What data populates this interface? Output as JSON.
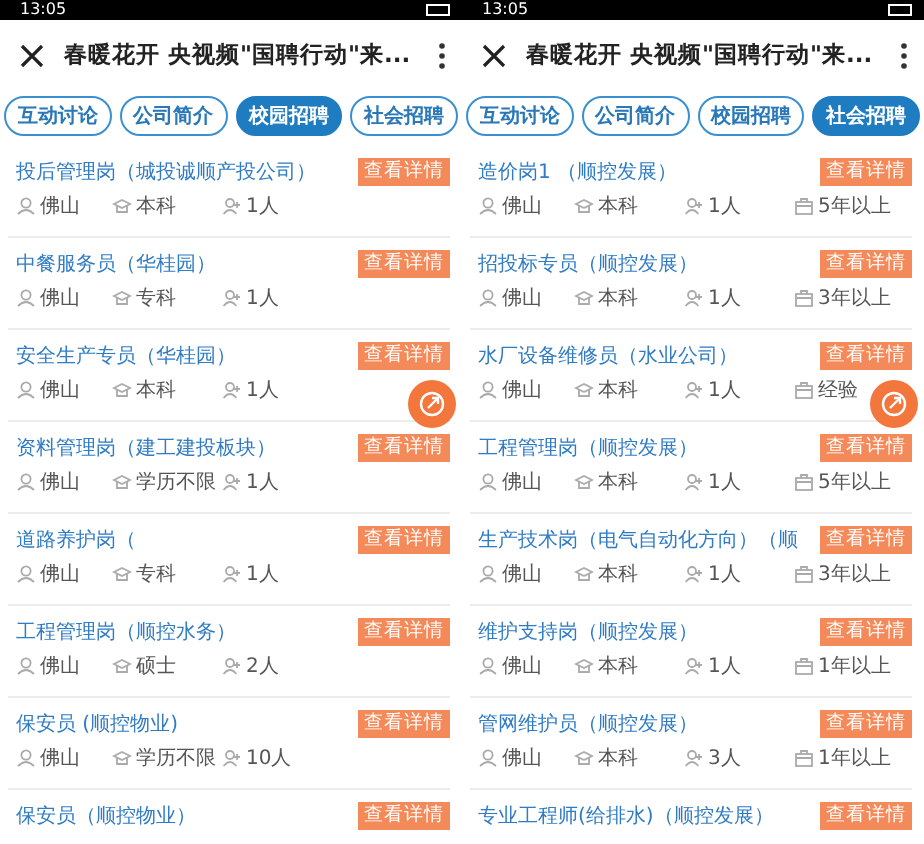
{
  "panels": [
    {
      "status_bar": {
        "time": "13:05"
      },
      "header": {
        "title": "春暖花开 央视频\"国聘行动\"来..."
      },
      "tabs": [
        {
          "label": "互动讨论",
          "selected": false
        },
        {
          "label": "公司简介",
          "selected": false
        },
        {
          "label": "校园招聘",
          "selected": true
        },
        {
          "label": "社会招聘",
          "selected": false
        }
      ],
      "jobs": [
        {
          "title": "投后管理岗（城投诚顺产投公司）",
          "button": "查看详情",
          "meta": [
            {
              "kind": "location",
              "text": "佛山"
            },
            {
              "kind": "education",
              "text": "本科"
            },
            {
              "kind": "headcount",
              "text": "1人"
            }
          ]
        },
        {
          "title": "中餐服务员（华桂园）",
          "button": "查看详情",
          "meta": [
            {
              "kind": "location",
              "text": "佛山"
            },
            {
              "kind": "education",
              "text": "专科"
            },
            {
              "kind": "headcount",
              "text": "1人"
            }
          ]
        },
        {
          "title": "安全生产专员（华桂园）",
          "button": "查看详情",
          "meta": [
            {
              "kind": "location",
              "text": "佛山"
            },
            {
              "kind": "education",
              "text": "本科"
            },
            {
              "kind": "headcount",
              "text": "1人"
            }
          ]
        },
        {
          "title": "资料管理岗（建工建投板块）",
          "button": "查看详情",
          "meta": [
            {
              "kind": "location",
              "text": "佛山"
            },
            {
              "kind": "education",
              "text": "学历不限"
            },
            {
              "kind": "headcount",
              "text": "1人"
            }
          ]
        },
        {
          "title": "道路养护岗（",
          "button": "查看详情",
          "meta": [
            {
              "kind": "location",
              "text": "佛山"
            },
            {
              "kind": "education",
              "text": "专科"
            },
            {
              "kind": "headcount",
              "text": "1人"
            }
          ]
        },
        {
          "title": "工程管理岗（顺控水务）",
          "button": "查看详情",
          "meta": [
            {
              "kind": "location",
              "text": "佛山"
            },
            {
              "kind": "education",
              "text": "硕士"
            },
            {
              "kind": "headcount",
              "text": "2人"
            }
          ]
        },
        {
          "title": "保安员 (顺控物业)",
          "button": "查看详情",
          "meta": [
            {
              "kind": "location",
              "text": "佛山"
            },
            {
              "kind": "education",
              "text": "学历不限"
            },
            {
              "kind": "headcount",
              "text": "10人"
            }
          ]
        },
        {
          "title": "保安员（顺控物业）",
          "button": "查看详情"
        }
      ]
    },
    {
      "status_bar": {
        "time": "13:05"
      },
      "header": {
        "title": "春暖花开 央视频\"国聘行动\"来..."
      },
      "tabs": [
        {
          "label": "互动讨论",
          "selected": false
        },
        {
          "label": "公司简介",
          "selected": false
        },
        {
          "label": "校园招聘",
          "selected": false
        },
        {
          "label": "社会招聘",
          "selected": true
        }
      ],
      "jobs": [
        {
          "title": "造价岗1 （顺控发展）",
          "button": "查看详情",
          "meta": [
            {
              "kind": "location",
              "text": "佛山"
            },
            {
              "kind": "education",
              "text": "本科"
            },
            {
              "kind": "headcount",
              "text": "1人"
            },
            {
              "kind": "experience",
              "text": "5年以上"
            }
          ]
        },
        {
          "title": "招投标专员（顺控发展）",
          "button": "查看详情",
          "meta": [
            {
              "kind": "location",
              "text": "佛山"
            },
            {
              "kind": "education",
              "text": "本科"
            },
            {
              "kind": "headcount",
              "text": "1人"
            },
            {
              "kind": "experience",
              "text": "3年以上"
            }
          ]
        },
        {
          "title": "水厂设备维修员（水业公司）",
          "button": "查看详情",
          "meta": [
            {
              "kind": "location",
              "text": "佛山"
            },
            {
              "kind": "education",
              "text": "本科"
            },
            {
              "kind": "headcount",
              "text": "1人"
            },
            {
              "kind": "experience",
              "text": "经验"
            }
          ]
        },
        {
          "title": "工程管理岗（顺控发展）",
          "button": "查看详情",
          "meta": [
            {
              "kind": "location",
              "text": "佛山"
            },
            {
              "kind": "education",
              "text": "本科"
            },
            {
              "kind": "headcount",
              "text": "1人"
            },
            {
              "kind": "experience",
              "text": "5年以上"
            }
          ]
        },
        {
          "title": "生产技术岗（电气自动化方向）（顺",
          "button": "查看详情",
          "meta": [
            {
              "kind": "location",
              "text": "佛山"
            },
            {
              "kind": "education",
              "text": "本科"
            },
            {
              "kind": "headcount",
              "text": "1人"
            },
            {
              "kind": "experience",
              "text": "3年以上"
            }
          ]
        },
        {
          "title": "维护支持岗（顺控发展）",
          "button": "查看详情",
          "meta": [
            {
              "kind": "location",
              "text": "佛山"
            },
            {
              "kind": "education",
              "text": "本科"
            },
            {
              "kind": "headcount",
              "text": "1人"
            },
            {
              "kind": "experience",
              "text": "1年以上"
            }
          ]
        },
        {
          "title": "管网维护员（顺控发展）",
          "button": "查看详情",
          "meta": [
            {
              "kind": "location",
              "text": "佛山"
            },
            {
              "kind": "education",
              "text": "本科"
            },
            {
              "kind": "headcount",
              "text": "3人"
            },
            {
              "kind": "experience",
              "text": "1年以上"
            }
          ]
        },
        {
          "title": "专业工程师(给排水)（顺控发展）",
          "button": "查看详情"
        }
      ]
    }
  ]
}
